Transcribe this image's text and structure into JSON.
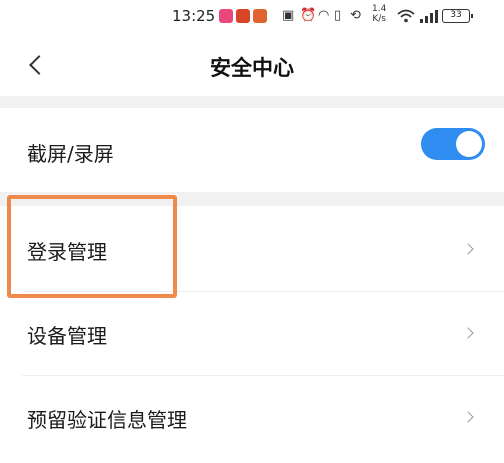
{
  "status_bar": {
    "time": "13:25",
    "net_speed_value": "1.4",
    "net_speed_unit": "K/s",
    "battery": "33",
    "signal_label": "5G"
  },
  "nav": {
    "title": "安全中心",
    "back_icon": "chevron-left-icon"
  },
  "rows": {
    "screenshot": {
      "label": "截屏/录屏",
      "toggle_on": true
    },
    "login": {
      "label": "登录管理"
    },
    "device": {
      "label": "设备管理"
    },
    "verification": {
      "label": "预留验证信息管理"
    }
  },
  "colors": {
    "accent": "#2f8cf0",
    "highlight": "#f08a4b",
    "divider": "#f1f1f1",
    "app_badge_1": "#e8487a",
    "app_badge_2": "#d9432a",
    "app_badge_3": "#e0622f"
  }
}
